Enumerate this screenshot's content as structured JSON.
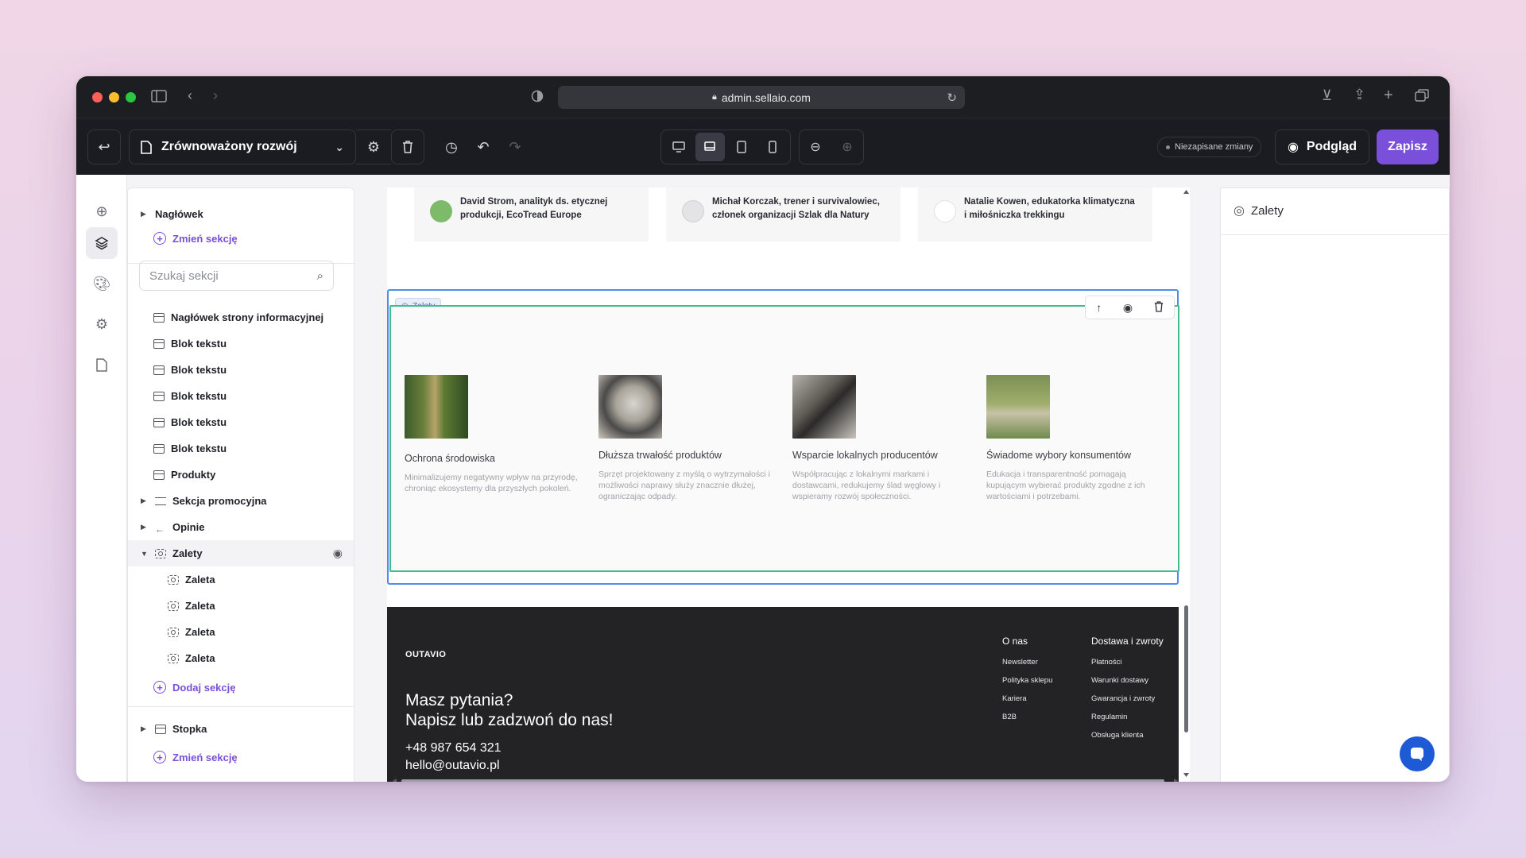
{
  "browser": {
    "url": "admin.sellaio.com",
    "traffic_colors": [
      "#ff5f57",
      "#febc2e",
      "#28c840"
    ]
  },
  "toolbar": {
    "page_name": "Zrównoważony rozwój",
    "unsaved_label": "Niezapisane zmiany",
    "preview_label": "Podgląd",
    "save_label": "Zapisz",
    "accent": "#7a4fd9"
  },
  "tree": {
    "header_section": "Nagłówek",
    "change_section": "Zmień sekcję",
    "search_placeholder": "Szukaj sekcji",
    "items": [
      {
        "label": "Nagłówek strony informacyjnej",
        "icon": "section-icon"
      },
      {
        "label": "Blok tekstu",
        "icon": "section-icon"
      },
      {
        "label": "Blok tekstu",
        "icon": "section-icon"
      },
      {
        "label": "Blok tekstu",
        "icon": "section-icon"
      },
      {
        "label": "Blok tekstu",
        "icon": "section-icon"
      },
      {
        "label": "Blok tekstu",
        "icon": "section-icon"
      },
      {
        "label": "Produkty",
        "icon": "section-icon"
      },
      {
        "label": "Sekcja promocyjna",
        "icon": "lines-icon"
      },
      {
        "label": "Opinie",
        "icon": "quote-icon"
      },
      {
        "label": "Zalety",
        "icon": "focus-icon"
      },
      {
        "label": "Zaleta",
        "icon": "focus-icon"
      },
      {
        "label": "Zaleta",
        "icon": "focus-icon"
      },
      {
        "label": "Zaleta",
        "icon": "focus-icon"
      },
      {
        "label": "Zaleta",
        "icon": "focus-icon"
      }
    ],
    "add_section": "Dodaj sekcję",
    "footer_section": "Stopka",
    "footer_change": "Zmień sekcję"
  },
  "canvas": {
    "testimonials": [
      {
        "text": "David Strom, analityk ds. etycznej produkcji, EcoTread Europe",
        "avatar_color": "#7dbb6b"
      },
      {
        "text": "Michał Korczak, trener i survivalowiec, członek organizacji Szlak dla Natury",
        "avatar_color": "#e4e4e6"
      },
      {
        "text": "Natalie Kowen, edukatorka klimatyczna i miłośniczka trekkingu",
        "avatar_color": "#3b3b3f"
      }
    ],
    "section_tag": "Zalety",
    "features": [
      {
        "title": "Ochrona środowiska",
        "desc": "Minimalizujemy negatywny wpływ na przyrodę, chroniąc ekosystemy dla przyszłych pokoleń.",
        "image": "forest-path"
      },
      {
        "title": "Dłuższa trwałość produktów",
        "desc": "Sprzęt projektowany z myślą o wytrzymałości i możliwości naprawy służy znacznie dłużej, ograniczając odpady.",
        "image": "bike-repair"
      },
      {
        "title": "Wsparcie lokalnych producentów",
        "desc": "Współpracując z lokalnymi markami i dostawcami, redukujemy ślad węglowy i wspieramy rozwój społeczności.",
        "image": "sewing-machine"
      },
      {
        "title": "Świadome wybory konsumentów",
        "desc": "Edukacja i transparentność pomagają kupującym wybierać produkty zgodne z ich wartościami i potrzebami.",
        "image": "yoga-outdoors"
      }
    ],
    "footer": {
      "brand": "OUTAVIO",
      "question": "Masz pytania?",
      "cta": "Napisz lub zadzwoń do nas!",
      "phone": "+48 987 654 321",
      "email": "hello@outavio.pl",
      "col1": {
        "head": "O nas",
        "links": [
          "Newsletter",
          "Polityka sklepu",
          "Kariera",
          "B2B"
        ]
      },
      "col2": {
        "head": "Dostawa i zwroty",
        "links": [
          "Płatności",
          "Warunki dostawy",
          "Gwarancja i zwroty",
          "Regulamin",
          "Obsługa klienta"
        ]
      }
    }
  },
  "properties": {
    "title": "Zalety"
  }
}
